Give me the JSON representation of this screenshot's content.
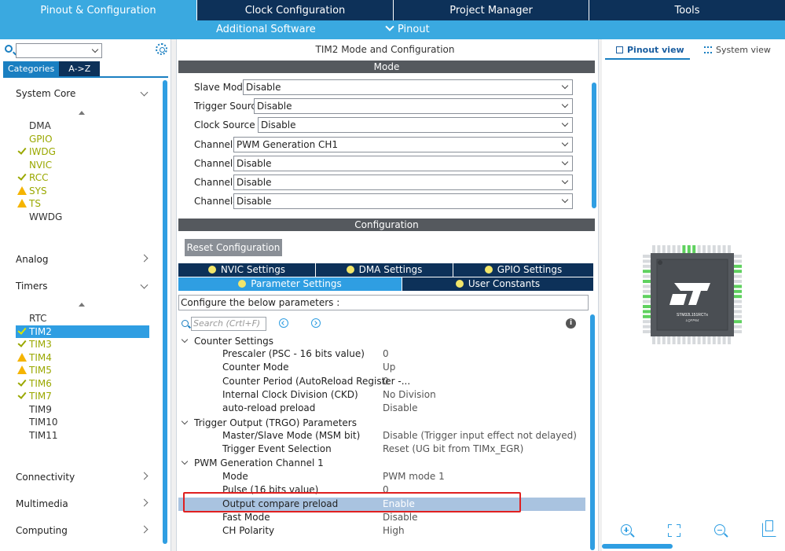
{
  "top_tabs": [
    "Pinout & Configuration",
    "Clock Configuration",
    "Project Manager",
    "Tools"
  ],
  "sub_menu": {
    "additional_software": "Additional Software",
    "pinout": "Pinout"
  },
  "left": {
    "categories_tab": "Categories",
    "az_tab": "A->Z",
    "groups": {
      "system_core": "System Core",
      "analog": "Analog",
      "timers": "Timers",
      "connectivity": "Connectivity",
      "multimedia": "Multimedia",
      "computing": "Computing"
    },
    "system_core_items": [
      {
        "label": "DMA",
        "state": "none"
      },
      {
        "label": "GPIO",
        "state": "green"
      },
      {
        "label": "IWDG",
        "state": "check"
      },
      {
        "label": "NVIC",
        "state": "green"
      },
      {
        "label": "RCC",
        "state": "check"
      },
      {
        "label": "SYS",
        "state": "warn"
      },
      {
        "label": "TS",
        "state": "warn"
      },
      {
        "label": "WWDG",
        "state": "none"
      }
    ],
    "timers_items": [
      {
        "label": "RTC",
        "state": "none"
      },
      {
        "label": "TIM2",
        "state": "check",
        "selected": true
      },
      {
        "label": "TIM3",
        "state": "check"
      },
      {
        "label": "TIM4",
        "state": "warn"
      },
      {
        "label": "TIM5",
        "state": "warn"
      },
      {
        "label": "TIM6",
        "state": "check"
      },
      {
        "label": "TIM7",
        "state": "check"
      },
      {
        "label": "TIM9",
        "state": "none"
      },
      {
        "label": "TIM10",
        "state": "none"
      },
      {
        "label": "TIM11",
        "state": "none"
      }
    ]
  },
  "middle": {
    "title": "TIM2 Mode and Configuration",
    "mode_band": "Mode",
    "mode_rows": [
      {
        "label": "Slave Mode",
        "value": "Disable"
      },
      {
        "label": "Trigger Source",
        "value": "Disable"
      },
      {
        "label": "Clock Source",
        "value": "Disable"
      },
      {
        "label": "Channel1",
        "value": "PWM Generation CH1"
      },
      {
        "label": "Channel2",
        "value": "Disable"
      },
      {
        "label": "Channel3",
        "value": "Disable"
      },
      {
        "label": "Channel4",
        "value": "Disable"
      }
    ],
    "config_band": "Configuration",
    "reset_button": "Reset Configuration",
    "tabs": {
      "nvic": "NVIC Settings",
      "dma": "DMA Settings",
      "gpio": "GPIO Settings",
      "parameter": "Parameter Settings",
      "user_constants": "User Constants"
    },
    "configure_text": "Configure the below parameters :",
    "search_placeholder": "Search (Crtl+F)",
    "sections": {
      "counter": "Counter Settings",
      "trgo": "Trigger Output (TRGO) Parameters",
      "pwm": "PWM Generation Channel 1"
    },
    "counter_params": [
      {
        "name": "Prescaler (PSC - 16 bits value)",
        "value": "0"
      },
      {
        "name": "Counter Mode",
        "value": "Up"
      },
      {
        "name": "Counter Period (AutoReload Register -...",
        "value": "0"
      },
      {
        "name": "Internal Clock Division (CKD)",
        "value": "No Division"
      },
      {
        "name": "auto-reload preload",
        "value": "Disable"
      }
    ],
    "trgo_params": [
      {
        "name": "Master/Slave Mode (MSM bit)",
        "value": "Disable (Trigger input effect not delayed)"
      },
      {
        "name": "Trigger Event Selection",
        "value": "Reset (UG bit from TIMx_EGR)"
      }
    ],
    "pwm_params": [
      {
        "name": "Mode",
        "value": "PWM mode 1"
      },
      {
        "name": "Pulse (16 bits value)",
        "value": "0"
      },
      {
        "name": "Output compare preload",
        "value": "Enable"
      },
      {
        "name": "Fast Mode",
        "value": "Disable"
      },
      {
        "name": "CH Polarity",
        "value": "High"
      }
    ]
  },
  "right": {
    "pinout_view": "Pinout view",
    "system_view": "System view",
    "chip_name": "STM32L151RCTx",
    "package": "LQFP64",
    "logo": "ST"
  },
  "colors": {
    "active_tab": "#3aa9e0",
    "dark_tab": "#0d3159",
    "selection": "#2f9ee2",
    "warn": "#f5b400",
    "ok": "#9aa800",
    "highlight_box": "#e02020"
  }
}
